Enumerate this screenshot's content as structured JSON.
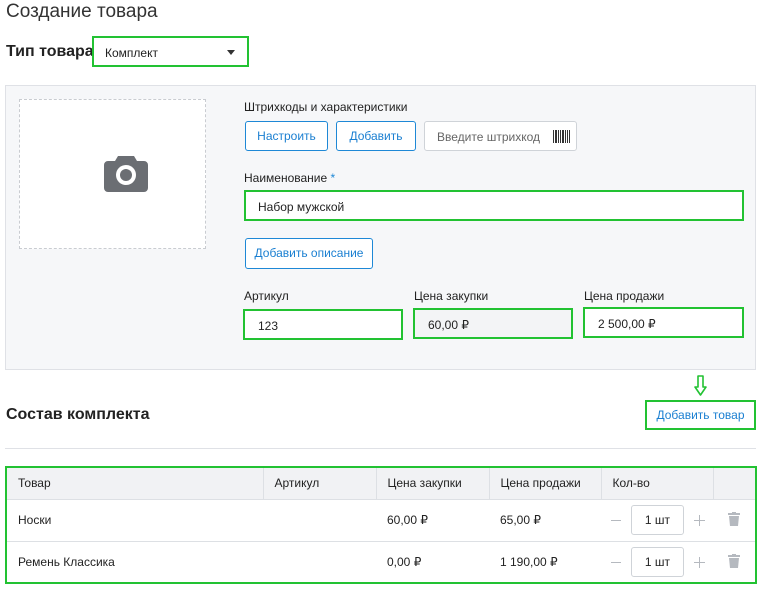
{
  "page": {
    "title": "Создание товара"
  },
  "product_type": {
    "label": "Тип товара",
    "selected": "Комплект"
  },
  "barcodes": {
    "label": "Штрихкоды и характеристики",
    "configure_label": "Настроить",
    "add_label": "Добавить",
    "placeholder": "Введите штрихкод"
  },
  "name": {
    "label": "Наименование",
    "required_mark": "*",
    "value": "Набор мужской"
  },
  "description": {
    "add_label": "Добавить описание"
  },
  "article": {
    "label": "Артикул",
    "value": "123"
  },
  "purchase_price": {
    "label": "Цена закупки",
    "value": "60,00 ₽"
  },
  "sale_price": {
    "label": "Цена продажи",
    "value": "2 500,00 ₽"
  },
  "bundle": {
    "title": "Состав комплекта",
    "add_product_label": "Добавить товар",
    "columns": [
      "Товар",
      "Артикул",
      "Цена закупки",
      "Цена продажи",
      "Кол-во"
    ],
    "rows": [
      {
        "name": "Носки",
        "article": "",
        "purchase": "60,00 ₽",
        "sale": "65,00 ₽",
        "qty": "1 шт"
      },
      {
        "name": "Ремень Классика",
        "article": "",
        "purchase": "0,00 ₽",
        "sale": "1 190,00 ₽",
        "qty": "1 шт"
      }
    ]
  },
  "colors": {
    "accent": "#1e88d6",
    "highlight": "#22c232",
    "panel_bg": "#f6f7f9"
  },
  "icons": [
    "camera-icon",
    "barcode-icon",
    "chevron-down-icon",
    "arrow-down-icon",
    "minus-icon",
    "plus-icon",
    "trash-icon"
  ]
}
